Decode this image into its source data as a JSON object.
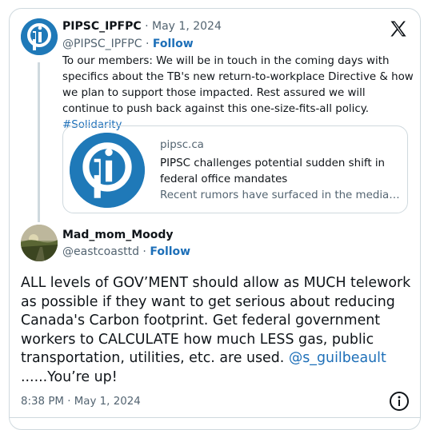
{
  "quoted_tweet": {
    "display_name": "PIPSC_IPFPC",
    "separator": " · ",
    "date": "May 1, 2024",
    "handle": "@PIPSC_IPFPC",
    "follow_label": "Follow",
    "text_main": "To our members:  We will be in touch in the coming days with specifics about the TB's new return-to-workplace Directive & how we plan to support those impacted. Rest assured we will continue to push back against this one-size-fits-all policy. ",
    "hashtag": "#Solidarity",
    "link_card": {
      "domain": "pipsc.ca",
      "title": "PIPSC challenges potential sudden shift in federal office mandates",
      "description": "Recent rumors have surfaced in the media regarding a potential sudden shift"
    }
  },
  "tweet": {
    "display_name": "Mad_mom_Moody",
    "handle": "@eastcoasttd",
    "separator": " · ",
    "follow_label": "Follow",
    "text_main": "ALL levels of GOV’MENT should allow as MUCH telework as possible if they want to get serious about reducing Canada's Carbon footprint.  Get federal government workers to CALCULATE how much LESS gas, public transportation, utilities, etc. are used. ",
    "mention": "@s_guilbeault",
    "text_end": "  ......You’re up!",
    "timestamp": "8:38 PM · May 1, 2024"
  },
  "icons": {
    "platform": "x-logo-icon",
    "info": "info-icon",
    "org_logo": "pipsc-logo"
  },
  "colors": {
    "link": "#1d6fb8",
    "muted": "#536471",
    "border": "#cfd9de",
    "brand_blue": "#1f79b8"
  }
}
